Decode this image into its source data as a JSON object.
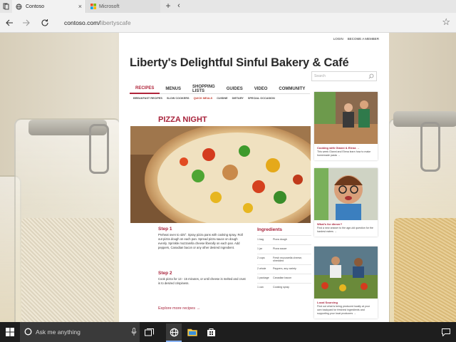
{
  "browser": {
    "active_tab": "Contoso",
    "inactive_tab": "Microsoft",
    "url_host": "contoso.com/",
    "url_path": "libertyscafe"
  },
  "site": {
    "top_links": [
      "LOGIN",
      "BECOME A MEMBER"
    ],
    "title": "Liberty's Delightful Sinful Bakery & Café",
    "search_placeholder": "Search",
    "nav": [
      "RECIPES",
      "MENUS",
      "SHOPPING LISTS",
      "GUIDES",
      "VIDEO",
      "COMMUNITY"
    ],
    "subnav": [
      "BREAKFAST RECIPES",
      "SLOW COOKERS",
      "QUICK MEALS",
      "CUISINE",
      "DIETARY",
      "SPECIAL OCCASION"
    ],
    "recipe_title": "PIZZA NIGHT",
    "step1_heading": "Step 1",
    "step1_text": "Preheat oven to 425°. Spray pizza pans with cooking spray. Roll out pizza dough on each pan. Spread pizza sauce on dough evenly. Sprinkle mozzarella cheese liberally on each pan. Add peppers, Canadian bacon or any other desired ingredient.",
    "step2_heading": "Step 2",
    "step2_text": "Cook pizza for 13 - 15 minutes, or until cheese is melted and crust is to desired crispiness.",
    "ingredients_heading": "Ingredients",
    "ingredients": [
      {
        "qty": "1 bag",
        "name": "Pizza dough"
      },
      {
        "qty": "1 jar",
        "name": "Pizza sauce"
      },
      {
        "qty": "2 cups",
        "name": "Fresh mozzarella cheese, shredded"
      },
      {
        "qty": "2 whole",
        "name": "Peppers, any variety"
      },
      {
        "qty": "1 package",
        "name": "Canadian bacon"
      },
      {
        "qty": "1 can",
        "name": "Cooking spray"
      }
    ],
    "explore": "Explore more recipes →",
    "cards": [
      {
        "title": "Cooking with Gianni & Elena →",
        "desc": "This week Gianni and Elena learn how to make homemade pasta →"
      },
      {
        "title": "What's for dinner?",
        "desc": "Find a new answer to the age-old question for the hardest eaters →"
      },
      {
        "title": "Local Sourcing",
        "desc": "Find out what is being produced locally at your own backyard for freshest ingredients and supporting your local producers →"
      }
    ]
  },
  "taskbar": {
    "search_placeholder": "Ask me anything"
  },
  "colors": {
    "accent": "#a8233b",
    "taskbar": "#1e1e1e"
  }
}
